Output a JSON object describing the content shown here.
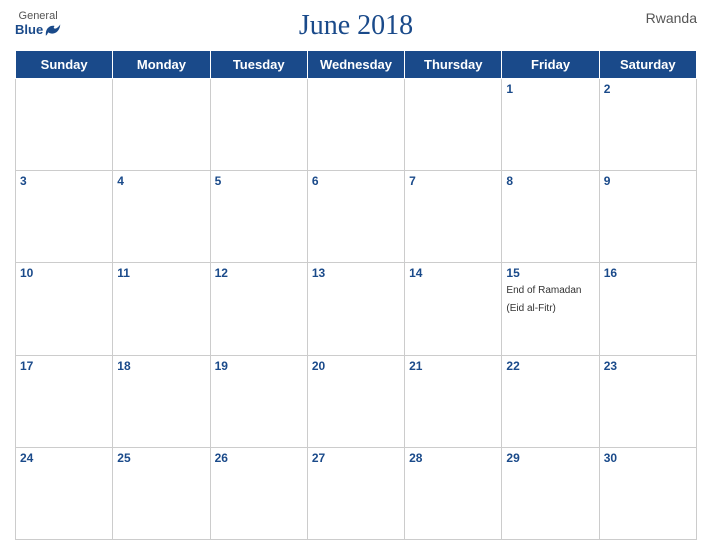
{
  "header": {
    "title": "June 2018",
    "country": "Rwanda",
    "logo": {
      "general": "General",
      "blue": "Blue"
    }
  },
  "weekdays": [
    "Sunday",
    "Monday",
    "Tuesday",
    "Wednesday",
    "Thursday",
    "Friday",
    "Saturday"
  ],
  "weeks": [
    [
      {
        "day": "",
        "empty": true
      },
      {
        "day": "",
        "empty": true
      },
      {
        "day": "",
        "empty": true
      },
      {
        "day": "",
        "empty": true
      },
      {
        "day": "",
        "empty": true
      },
      {
        "day": "1",
        "event": ""
      },
      {
        "day": "2",
        "event": ""
      }
    ],
    [
      {
        "day": "3",
        "event": ""
      },
      {
        "day": "4",
        "event": ""
      },
      {
        "day": "5",
        "event": ""
      },
      {
        "day": "6",
        "event": ""
      },
      {
        "day": "7",
        "event": ""
      },
      {
        "day": "8",
        "event": ""
      },
      {
        "day": "9",
        "event": ""
      }
    ],
    [
      {
        "day": "10",
        "event": ""
      },
      {
        "day": "11",
        "event": ""
      },
      {
        "day": "12",
        "event": ""
      },
      {
        "day": "13",
        "event": ""
      },
      {
        "day": "14",
        "event": ""
      },
      {
        "day": "15",
        "event": "End of Ramadan (Eid al-Fitr)"
      },
      {
        "day": "16",
        "event": ""
      }
    ],
    [
      {
        "day": "17",
        "event": ""
      },
      {
        "day": "18",
        "event": ""
      },
      {
        "day": "19",
        "event": ""
      },
      {
        "day": "20",
        "event": ""
      },
      {
        "day": "21",
        "event": ""
      },
      {
        "day": "22",
        "event": ""
      },
      {
        "day": "23",
        "event": ""
      }
    ],
    [
      {
        "day": "24",
        "event": ""
      },
      {
        "day": "25",
        "event": ""
      },
      {
        "day": "26",
        "event": ""
      },
      {
        "day": "27",
        "event": ""
      },
      {
        "day": "28",
        "event": ""
      },
      {
        "day": "29",
        "event": ""
      },
      {
        "day": "30",
        "event": ""
      }
    ]
  ]
}
